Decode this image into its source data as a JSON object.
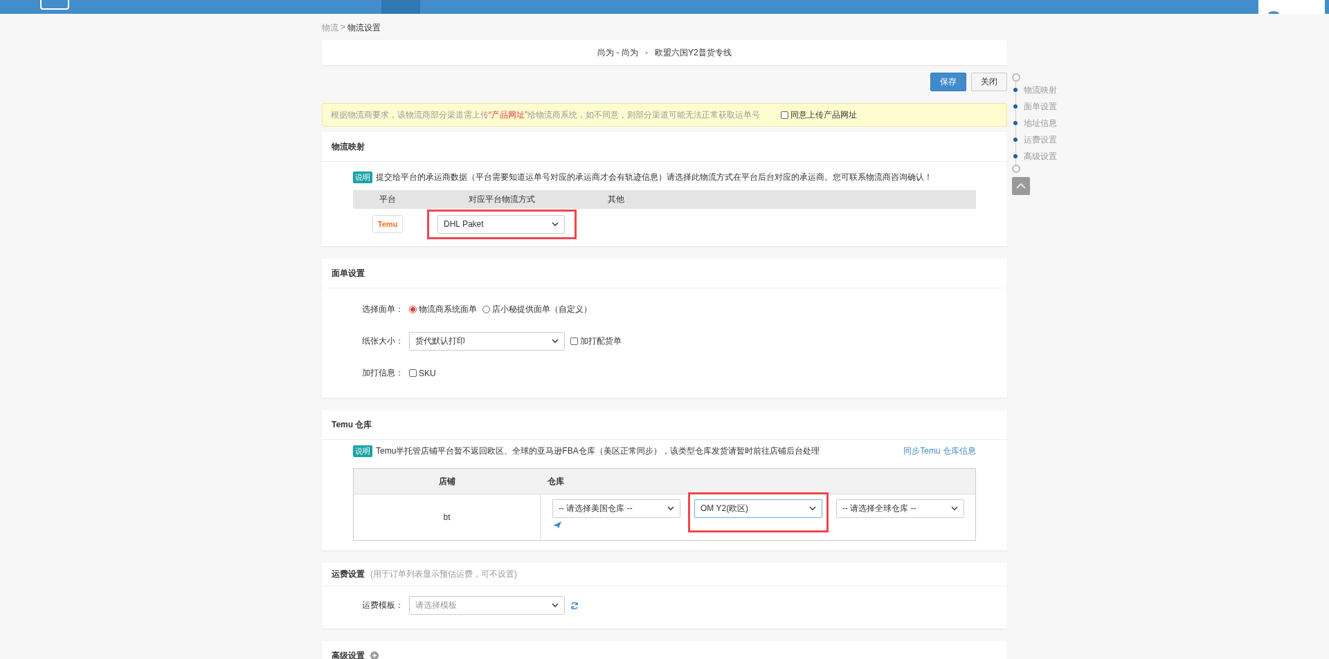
{
  "breadcrumb": {
    "parent": "物流",
    "separator": ">",
    "current": "物流设置"
  },
  "title": "尚为 - 尚为   -   欧盟六国Y2普货专线",
  "buttons": [
    {
      "label": "保存",
      "kind": "primary"
    },
    {
      "label": "关闭",
      "kind": "default"
    }
  ],
  "notice": {
    "before": "根据物流商要求，该物流商部分渠道需上传",
    "highlight": "“产品网址”",
    "after": "给物流商系统，如不同意，则部分渠道可能无法正常获取运单号",
    "checkbox": {
      "label": "同意上传产品网址",
      "checked": false
    }
  },
  "mapping": {
    "title": "物流映射",
    "tag": "说明",
    "note": "提交给平台的承运商数据（平台需要知道运单号对应的承运商才会有轨迹信息）请选择此物流方式在平台后台对应的承运商。您可联系物流商咨询确认！",
    "columns": [
      "平台",
      "对应平台物流方式",
      "其他"
    ],
    "rows": [
      {
        "platform": "Temu",
        "method": "DHL Paket",
        "highlighted": true
      }
    ]
  },
  "label_settings": {
    "title": "面单设置",
    "fields": [
      {
        "kind": "radio",
        "label": "选择面单：",
        "options": [
          {
            "label": "物流商系统面单",
            "selected": true
          },
          {
            "label": "店小秘提供面单（自定义）",
            "selected": false
          }
        ]
      },
      {
        "kind": "select",
        "label": "纸张大小：",
        "value": "货代默认打印",
        "checkbox": {
          "label": "加打配货单",
          "checked": false
        }
      },
      {
        "kind": "checkboxes",
        "label": "加打信息：",
        "options": [
          {
            "label": "SKU",
            "checked": false
          }
        ]
      }
    ]
  },
  "warehouse": {
    "title": "Temu 仓库",
    "tag": "说明",
    "note": "Temu半托管店铺平台暂不返回欧区、全球的亚马逊FBA仓库（美区正常同步），该类型仓库发货请暂时前往店铺后台处理",
    "link": "同步Temu 仓库信息",
    "columns": [
      "店铺",
      "仓库"
    ],
    "rows": [
      {
        "shop": "bt",
        "selects": [
          {
            "value": "-- 请选择美国仓库 --",
            "highlighted": false
          },
          {
            "value": "OM Y2(欧区)",
            "highlighted": true
          },
          {
            "value": "-- 请选择全球仓库 --",
            "highlighted": false
          }
        ]
      }
    ]
  },
  "freight": {
    "title": "运费设置",
    "hint": "(用于订单列表显示预估运费，可不设置)",
    "label": "运费模板：",
    "placeholder": "请选择模板"
  },
  "advanced": {
    "title": "高级设置"
  },
  "side_nav": {
    "items": [
      "物流映射",
      "面单设置",
      "地址信息",
      "运费设置",
      "高级设置"
    ]
  }
}
